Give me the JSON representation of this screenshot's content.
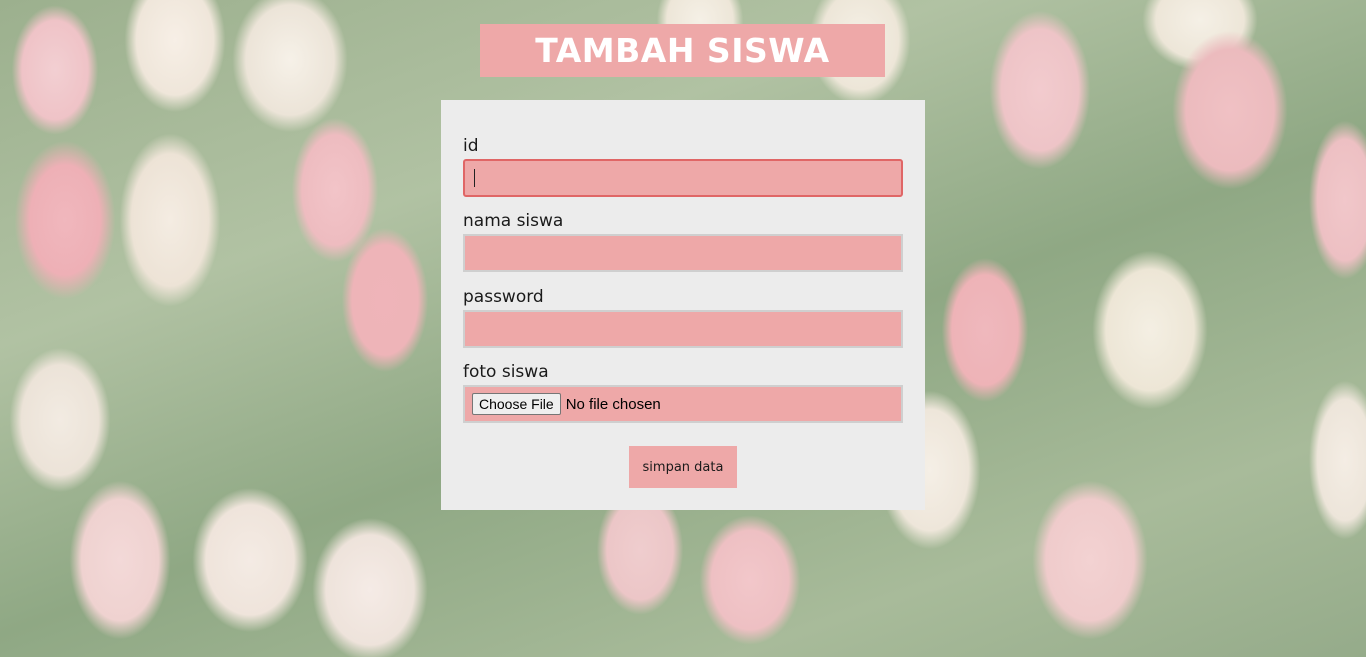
{
  "page": {
    "title": "TAMBAH SISWA"
  },
  "form": {
    "fields": [
      {
        "label": "id",
        "value": "",
        "placeholder": ""
      },
      {
        "label": "nama siswa",
        "value": "",
        "placeholder": ""
      },
      {
        "label": "password",
        "value": "",
        "placeholder": ""
      }
    ],
    "file_field": {
      "label": "foto siswa",
      "button_label": "Choose File",
      "status": "No file chosen"
    },
    "submit_label": "simpan data"
  },
  "colors": {
    "accent": "#eea8a8",
    "card_background": "#ececec",
    "focus_border": "#e06666"
  }
}
